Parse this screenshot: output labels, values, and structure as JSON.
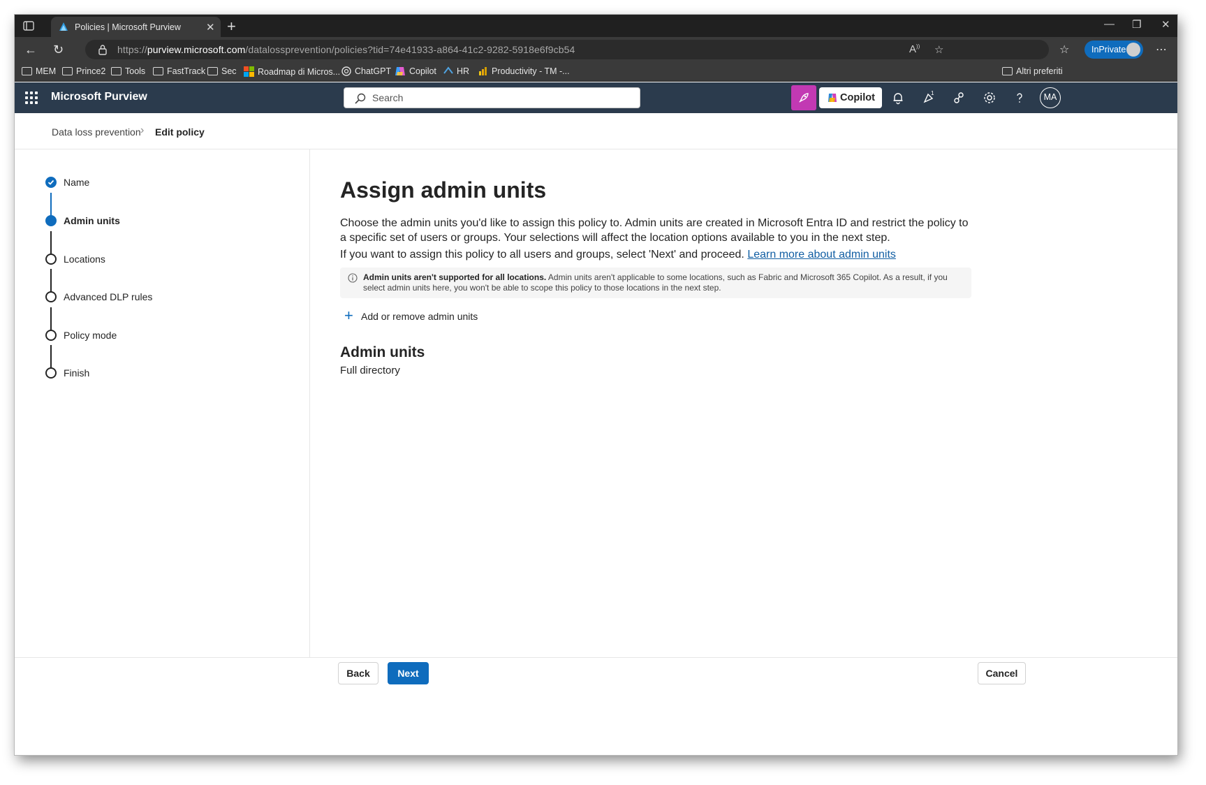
{
  "browser": {
    "tab_title": "Policies | Microsoft Purview",
    "url_prefix": "https://",
    "url_host": "purview.microsoft.com",
    "url_path": "/datalossprevention/policies?tid=74e41933-a864-41c2-9282-5918e6f9cb54",
    "inprivate_label": "InPrivate",
    "bookmarks": [
      "MEM",
      "Prince2",
      "Tools",
      "FastTrack",
      "Sec",
      "Roadmap di Micros...",
      "ChatGPT",
      "Copilot",
      "HR",
      "Productivity - TM -..."
    ],
    "other_favorites": "Altri preferiti"
  },
  "app": {
    "title": "Microsoft Purview",
    "search_placeholder": "Search",
    "copilot_label": "Copilot",
    "notification_badge": "1",
    "avatar_initials": "MA",
    "accent_color": "#0f6cbd",
    "header_color": "#2b3b4d"
  },
  "breadcrumb": {
    "parent": "Data loss prevention",
    "current": "Edit policy"
  },
  "steps": [
    {
      "label": "Name",
      "state": "done"
    },
    {
      "label": "Admin units",
      "state": "current"
    },
    {
      "label": "Locations",
      "state": "pending"
    },
    {
      "label": "Advanced DLP rules",
      "state": "pending"
    },
    {
      "label": "Policy mode",
      "state": "pending"
    },
    {
      "label": "Finish",
      "state": "pending"
    }
  ],
  "main": {
    "title": "Assign admin units",
    "description": "Choose the admin units you'd like to assign this policy to. Admin units are created in Microsoft Entra ID and restrict the policy to a specific set of users or groups. Your selections will affect the location options available to you in the next step.",
    "description2": "If you want to assign this policy to all users and groups, select 'Next' and proceed.",
    "learn_more_link": "Learn more about admin units",
    "notice_bold": "Admin units aren't supported for all locations.",
    "notice_text": "Admin units aren't applicable to some locations, such as Fabric and Microsoft 365 Copilot. As a result, if you select admin units here, you won't be able to scope this policy to those locations in the next step.",
    "add_button": "Add or remove admin units",
    "section_title": "Admin units",
    "section_value": "Full directory"
  },
  "footer": {
    "back_label": "Back",
    "next_label": "Next",
    "cancel_label": "Cancel"
  }
}
